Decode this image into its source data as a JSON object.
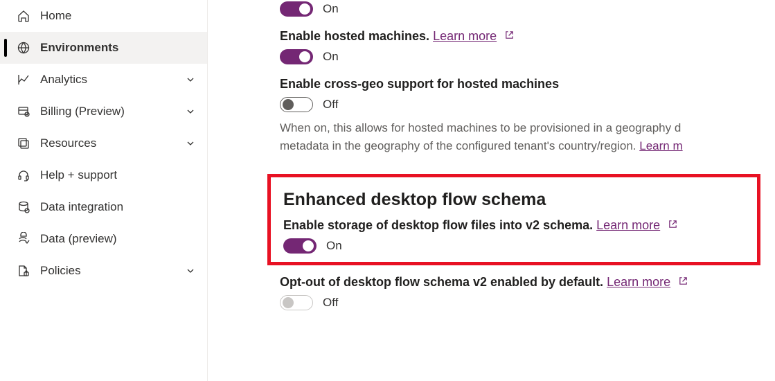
{
  "sidebar": {
    "items": [
      {
        "label": "Home"
      },
      {
        "label": "Environments"
      },
      {
        "label": "Analytics"
      },
      {
        "label": "Billing (Preview)"
      },
      {
        "label": "Resources"
      },
      {
        "label": "Help + support"
      },
      {
        "label": "Data integration"
      },
      {
        "label": "Data (preview)"
      },
      {
        "label": "Policies"
      }
    ]
  },
  "settings": {
    "toggle0_state": "On",
    "hosted_machines": {
      "title": "Enable hosted machines.",
      "learn": "Learn more",
      "state": "On"
    },
    "cross_geo": {
      "title": "Enable cross-geo support for hosted machines",
      "state": "Off",
      "desc_line1": "When on, this allows for hosted machines to be provisioned in a geography d",
      "desc_line2_a": "metadata in the geography of the configured tenant's country/region. ",
      "desc_line2_learn": "Learn m"
    },
    "enhanced_schema": {
      "heading": "Enhanced desktop flow schema",
      "v2_storage": {
        "label": "Enable storage of desktop flow files into v2 schema.",
        "learn": "Learn more",
        "state": "On"
      },
      "opt_out": {
        "label": "Opt-out of desktop flow schema v2 enabled by default.",
        "learn": "Learn more",
        "state": "Off"
      }
    }
  }
}
